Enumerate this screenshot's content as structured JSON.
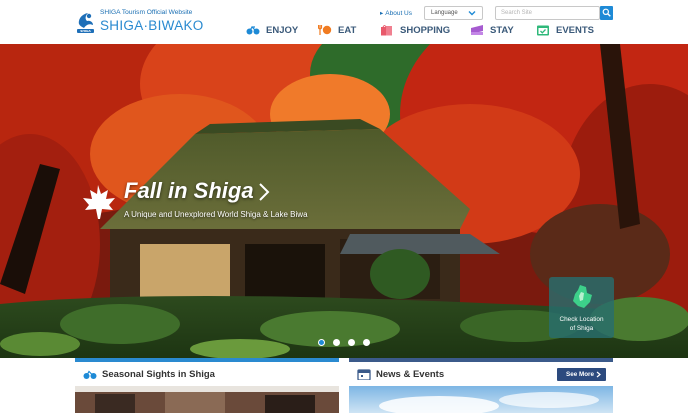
{
  "header": {
    "logo_sub": "SHIGA Tourism Official Website",
    "logo_main": "SHIGA·BIWAKO",
    "about_label": "About Us",
    "language_label": "Language",
    "search_placeholder": "Search Site"
  },
  "nav": [
    {
      "label": "ENJOY",
      "icon": "bicycle-icon"
    },
    {
      "label": "EAT",
      "icon": "food-icon"
    },
    {
      "label": "SHOPPING",
      "icon": "shopping-bag-icon"
    },
    {
      "label": "STAY",
      "icon": "bed-icon"
    },
    {
      "label": "EVENTS",
      "icon": "calendar-icon"
    }
  ],
  "hero": {
    "title": "Fall in Shiga",
    "subtitle": "A Unique and Unexplored World Shiga & Lake Biwa",
    "location_line1": "Check Location",
    "location_line2": "of Shiga",
    "slides": 4,
    "active_slide": 1
  },
  "sections": {
    "seasonal_title": "Seasonal Sights in Shiga",
    "news_title": "News & Events",
    "see_more": "See More"
  },
  "colors": {
    "brand_blue": "#2a8ad0",
    "nav_text": "#3b5a7a",
    "see_more_bg": "#2c4a7e"
  }
}
